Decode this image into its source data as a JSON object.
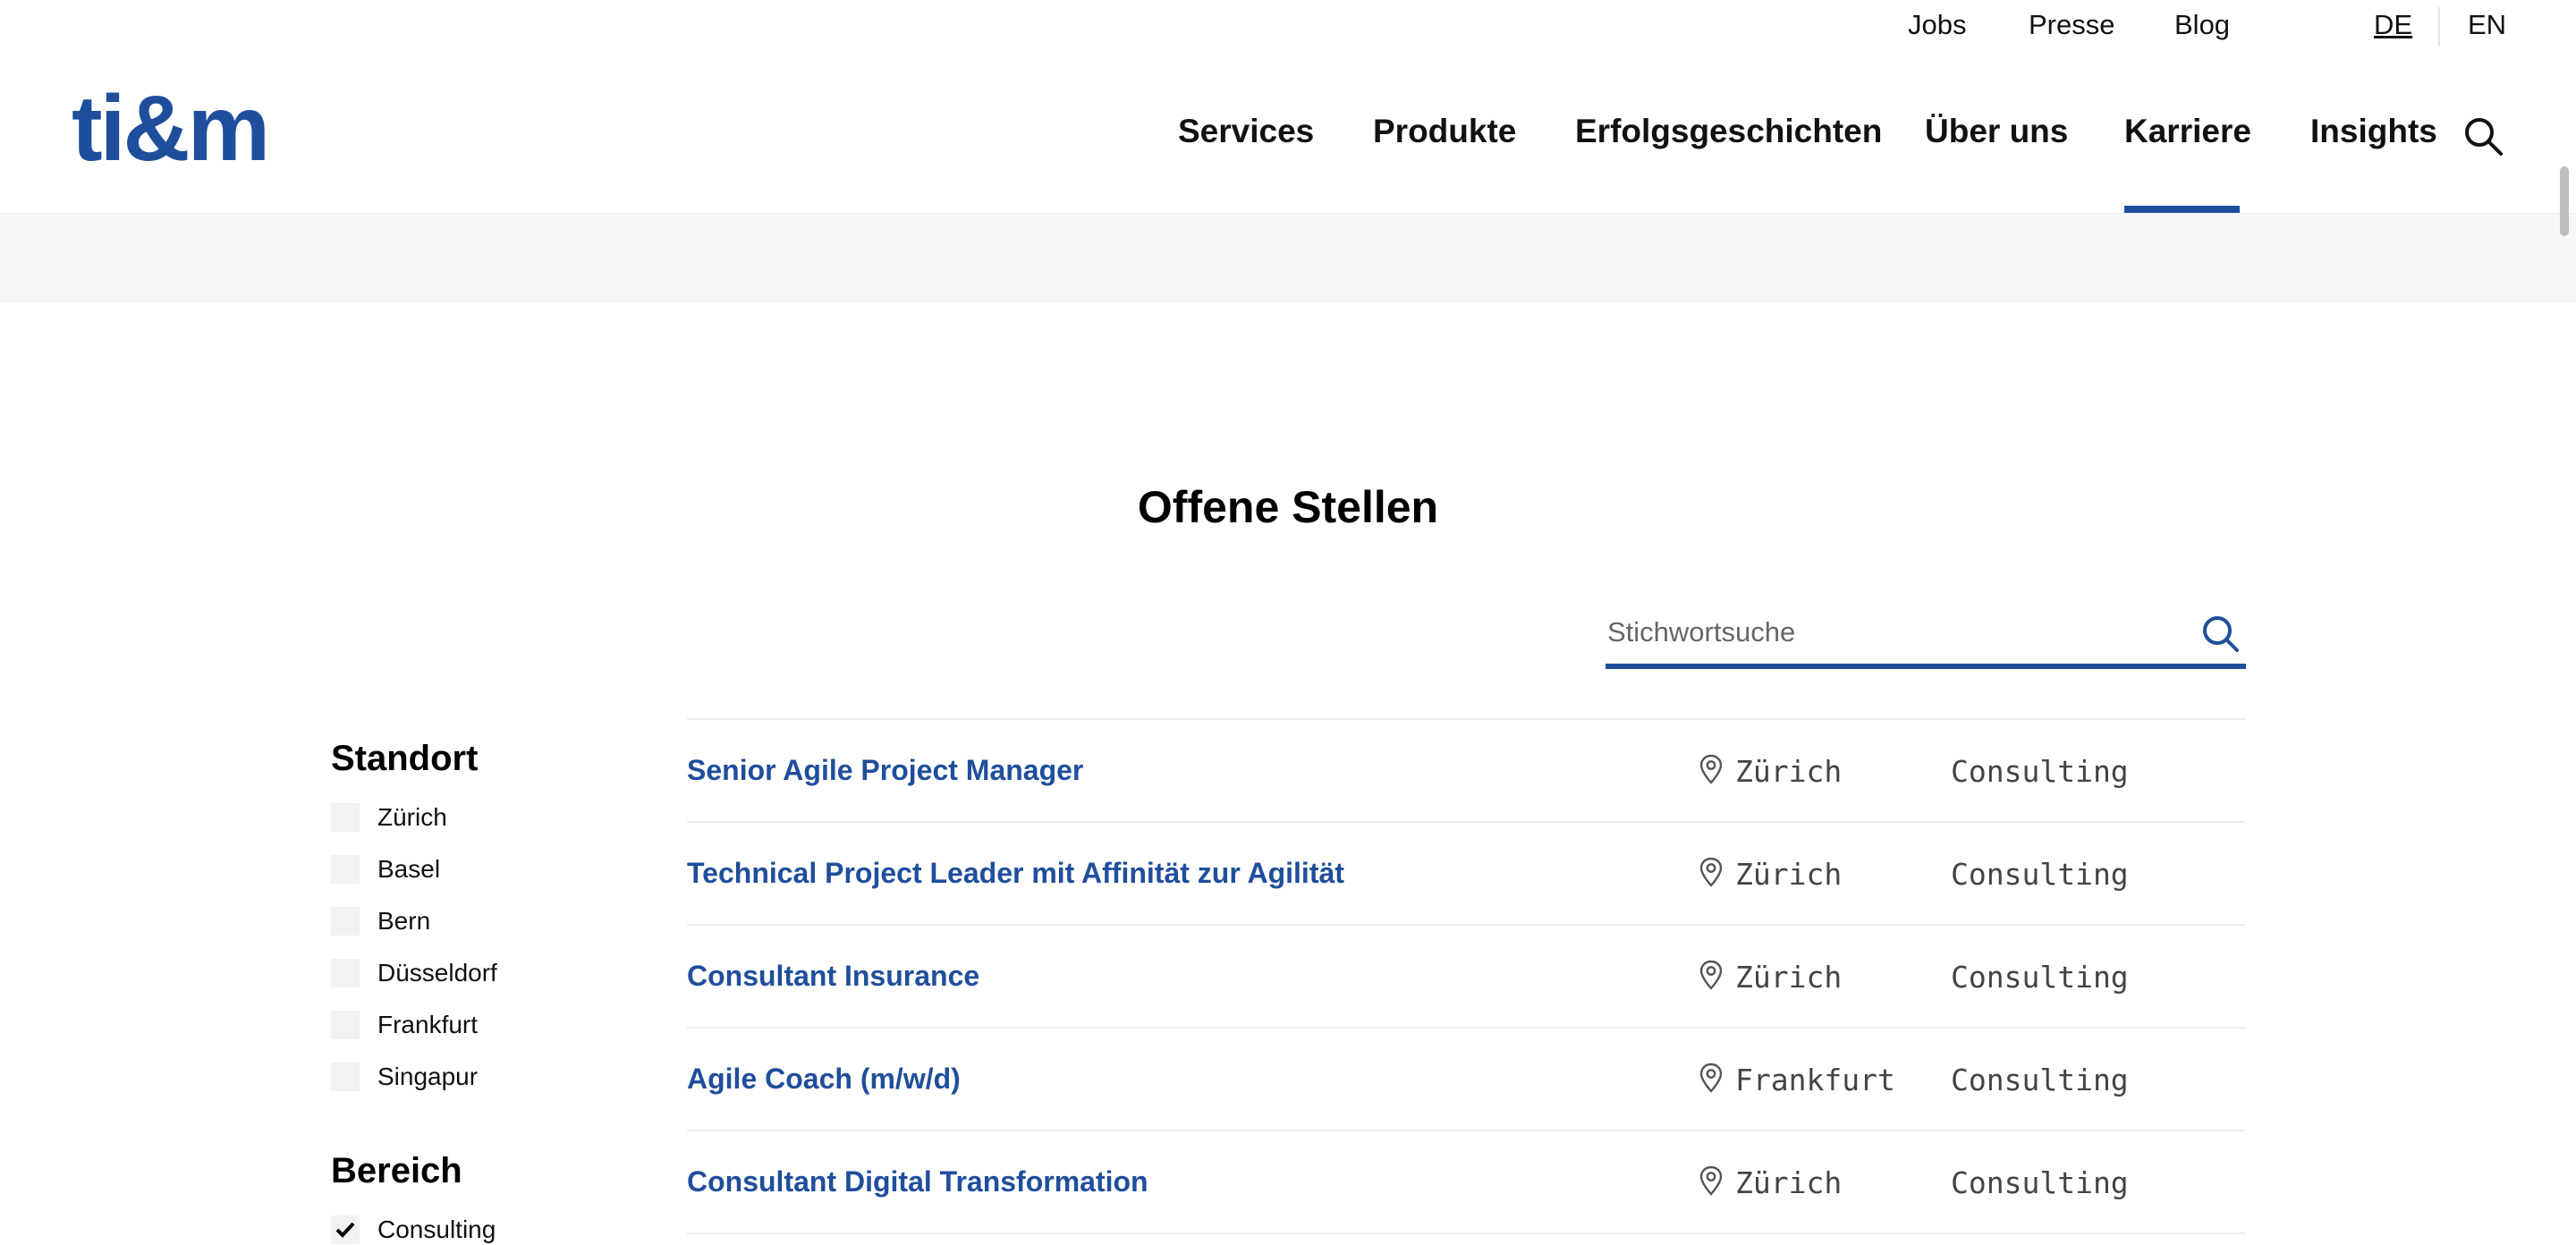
{
  "utility_nav": {
    "jobs": "Jobs",
    "presse": "Presse",
    "blog": "Blog",
    "lang_de": "DE",
    "lang_en": "EN"
  },
  "logo": "ti&m",
  "main_nav": {
    "items": [
      "Services",
      "Produkte",
      "Erfolgsgeschichten",
      "Über uns",
      "Karriere",
      "Insights"
    ],
    "active": "Karriere"
  },
  "section_title": "Offene Stellen",
  "search": {
    "placeholder": "Stichwortsuche"
  },
  "filters": {
    "standort": {
      "heading": "Standort",
      "options": [
        {
          "label": "Zürich",
          "checked": false
        },
        {
          "label": "Basel",
          "checked": false
        },
        {
          "label": "Bern",
          "checked": false
        },
        {
          "label": "Düsseldorf",
          "checked": false
        },
        {
          "label": "Frankfurt",
          "checked": false
        },
        {
          "label": "Singapur",
          "checked": false
        }
      ]
    },
    "bereich": {
      "heading": "Bereich",
      "options": [
        {
          "label": "Consulting",
          "checked": true
        }
      ]
    }
  },
  "jobs": [
    {
      "title": "Senior Agile Project Manager",
      "location": "Zürich",
      "department": "Consulting"
    },
    {
      "title": "Technical Project Leader mit Affinität zur Agilität",
      "location": "Zürich",
      "department": "Consulting"
    },
    {
      "title": "Consultant Insurance",
      "location": "Zürich",
      "department": "Consulting"
    },
    {
      "title": "Agile Coach (m/w/d)",
      "location": "Frankfurt",
      "department": "Consulting"
    },
    {
      "title": "Consultant Digital Transformation",
      "location": "Zürich",
      "department": "Consulting"
    }
  ],
  "colors": {
    "brand": "#1f4e9c",
    "band": "#f7f7f7",
    "checkbox": "#f0f2f4"
  },
  "icons": {
    "search": "search-icon",
    "location": "map-pin-icon",
    "check": "checkmark-icon"
  }
}
